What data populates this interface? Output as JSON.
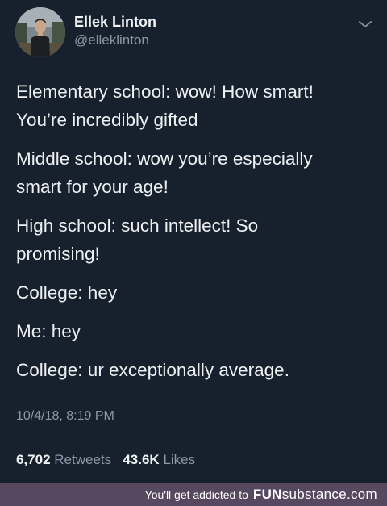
{
  "author": {
    "name": "Ellek Linton",
    "handle": "@elleklinton"
  },
  "tweet": {
    "paragraphs": [
      [
        "Elementary school: wow! How smart!",
        "You’re incredibly gifted"
      ],
      [
        "Middle school: wow you’re especially",
        "smart for your age!"
      ],
      [
        "High school: such intellect! So",
        "promising!"
      ],
      [
        "College: hey"
      ],
      [
        "Me: hey"
      ],
      [
        "College: ur exceptionally average."
      ]
    ],
    "timestamp": "10/4/18, 8:19 PM"
  },
  "stats": {
    "retweets_count": "6,702",
    "retweets_label": "Retweets",
    "likes_count": "43.6K",
    "likes_label": "Likes"
  },
  "footer": {
    "text": "You'll get addicted to",
    "brand_bold": "FUN",
    "brand_light": "substance",
    "brand_suffix": ".com"
  },
  "icons": {
    "menu": "chevron-down-icon",
    "avatar": "profile-photo"
  },
  "colors": {
    "background": "#17202d",
    "secondary_text": "#8b98a5",
    "footer_bar": "#56485e"
  }
}
